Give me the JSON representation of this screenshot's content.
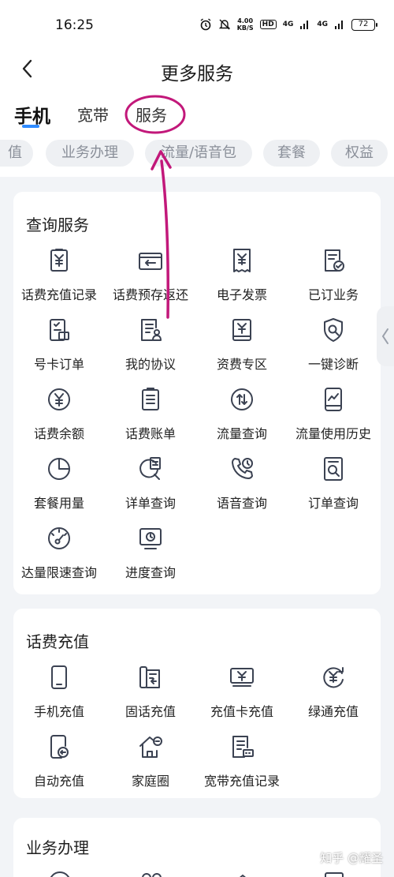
{
  "status_bar": {
    "time": "16:25",
    "net_speed_value": "4.00",
    "net_speed_unit": "KB/S",
    "hd_badge": "HD",
    "signal_1": "4G",
    "signal_2": "4G",
    "battery": "72"
  },
  "header": {
    "title": "更多服务"
  },
  "tabs": [
    {
      "label": "手机",
      "active": true
    },
    {
      "label": "宽带",
      "active": false
    },
    {
      "label": "服务",
      "active": false
    }
  ],
  "chips": [
    "值",
    "业务办理",
    "流量/语音包",
    "套餐",
    "权益"
  ],
  "sections": [
    {
      "title": "查询服务",
      "items": [
        {
          "label": "话费充值记录",
          "icon": "bill-yuan-icon"
        },
        {
          "label": "话费预存返还",
          "icon": "wallet-return-icon"
        },
        {
          "label": "电子发票",
          "icon": "invoice-icon"
        },
        {
          "label": "已订业务",
          "icon": "subscribed-doc-icon"
        },
        {
          "label": "号卡订单",
          "icon": "sim-order-icon"
        },
        {
          "label": "我的协议",
          "icon": "agreement-icon"
        },
        {
          "label": "资费专区",
          "icon": "tariff-book-icon"
        },
        {
          "label": "一键诊断",
          "icon": "diagnose-shield-icon"
        },
        {
          "label": "话费余额",
          "icon": "balance-yuan-icon"
        },
        {
          "label": "话费账单",
          "icon": "bill-list-icon"
        },
        {
          "label": "流量查询",
          "icon": "data-arrows-icon"
        },
        {
          "label": "流量使用历史",
          "icon": "phone-chart-icon"
        },
        {
          "label": "套餐用量",
          "icon": "pie-chart-icon"
        },
        {
          "label": "详单查询",
          "icon": "detail-search-icon"
        },
        {
          "label": "语音查询",
          "icon": "phone-clock-icon"
        },
        {
          "label": "订单查询",
          "icon": "order-search-icon"
        },
        {
          "label": "达量限速查询",
          "icon": "speedometer-icon"
        },
        {
          "label": "进度查询",
          "icon": "progress-monitor-icon"
        }
      ]
    },
    {
      "title": "话费充值",
      "items": [
        {
          "label": "手机充值",
          "icon": "mobile-phone-icon"
        },
        {
          "label": "固话充值",
          "icon": "landline-icon"
        },
        {
          "label": "充值卡充值",
          "icon": "recharge-card-icon"
        },
        {
          "label": "绿通充值",
          "icon": "green-channel-icon"
        },
        {
          "label": "自动充值",
          "icon": "auto-recharge-icon"
        },
        {
          "label": "家庭圈",
          "icon": "family-home-icon"
        },
        {
          "label": "宽带充值记录",
          "icon": "broadband-record-icon"
        }
      ]
    },
    {
      "title": "业务办理",
      "items": []
    }
  ],
  "watermark": "知乎 @耀圣",
  "colors": {
    "accent": "#2f8bff",
    "annotation": "#c2187a",
    "icon": "#3b4252",
    "background": "#f2f4f7"
  }
}
